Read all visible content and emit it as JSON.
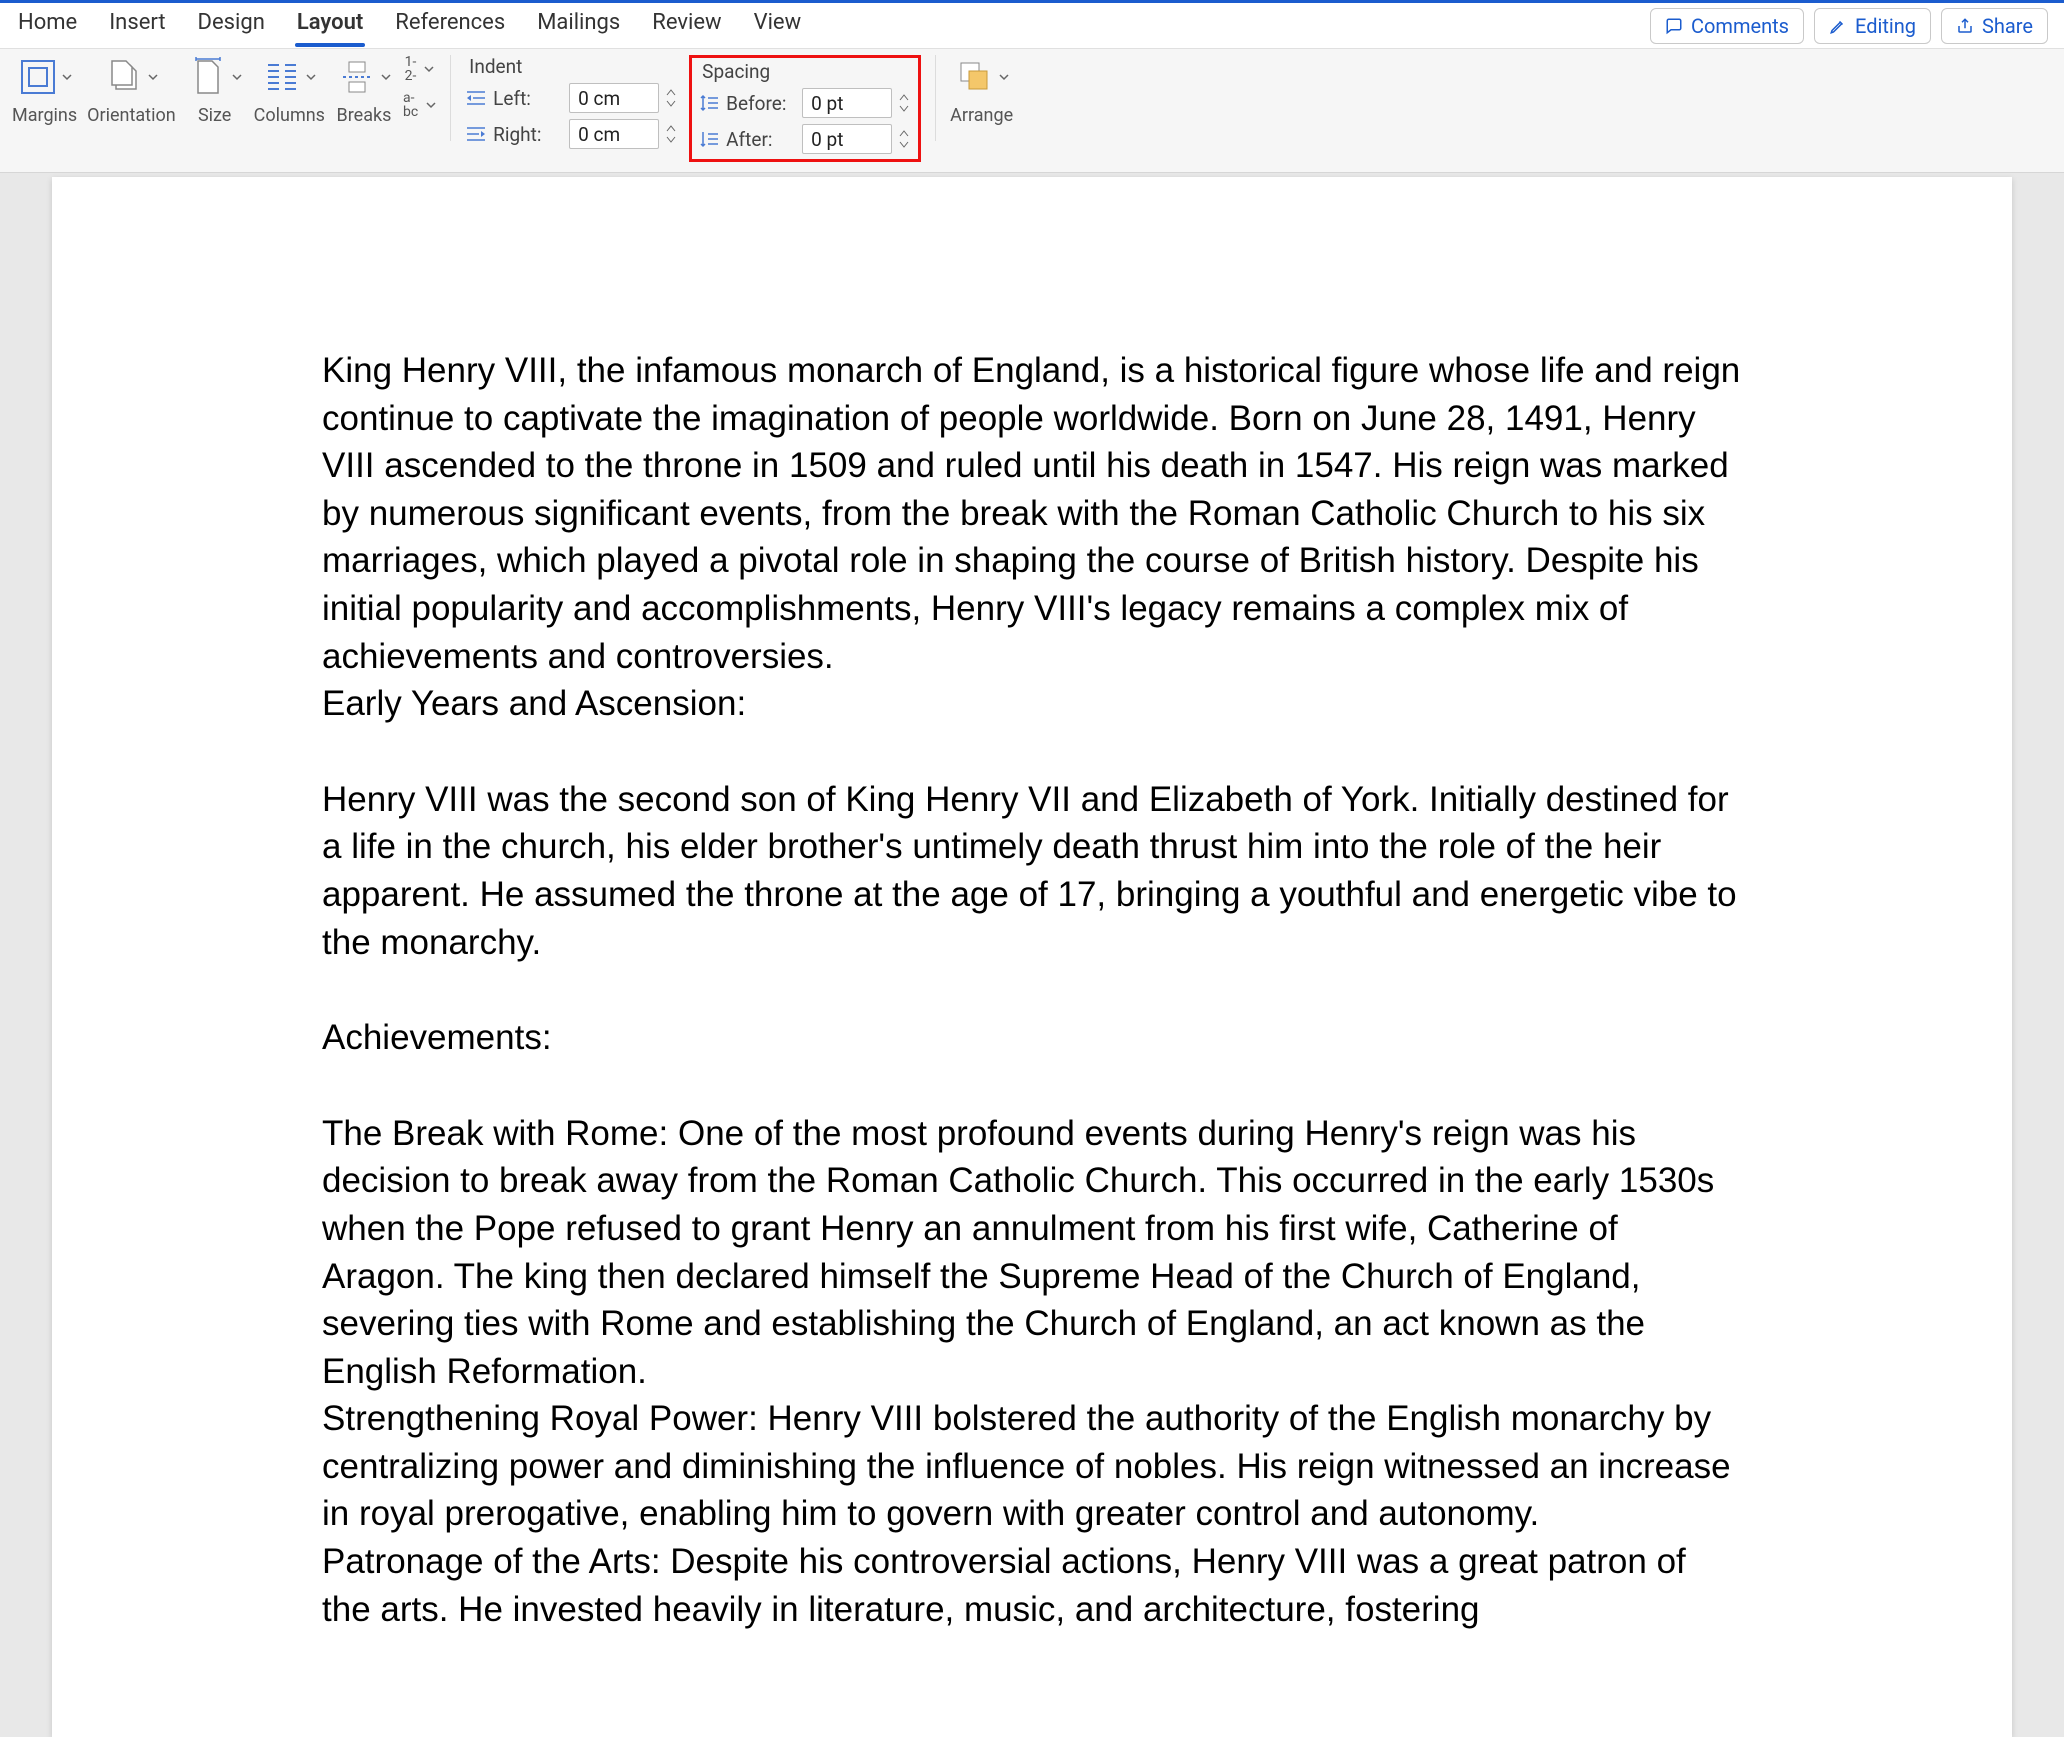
{
  "tabs": {
    "home": "Home",
    "insert": "Insert",
    "design": "Design",
    "layout": "Layout",
    "references": "References",
    "mailings": "Mailings",
    "review": "Review",
    "view": "View"
  },
  "actions": {
    "comments": "Comments",
    "editing": "Editing",
    "share": "Share"
  },
  "ribbon": {
    "margins": "Margins",
    "orientation": "Orientation",
    "size": "Size",
    "columns": "Columns",
    "breaks": "Breaks",
    "linenumbers": "1-\n2-",
    "hyphenation": "a-\nbc",
    "indent": {
      "title": "Indent",
      "left": "Left:",
      "right": "Right:",
      "left_val": "0 cm",
      "right_val": "0 cm"
    },
    "spacing": {
      "title": "Spacing",
      "before": "Before:",
      "after": "After:",
      "before_val": "0 pt",
      "after_val": "0 pt"
    },
    "arrange": "Arrange"
  },
  "doc": {
    "p1": "King Henry VIII, the infamous monarch of England, is a historical figure whose life and reign continue to captivate the imagination of people worldwide. Born on June 28, 1491, Henry VIII ascended to the throne in 1509 and ruled until his death in 1547. His reign was marked by numerous significant events, from the break with the Roman Catholic Church to his six marriages, which played a pivotal role in shaping the course of British history. Despite his initial popularity and accomplishments, Henry VIII's legacy remains a complex mix of achievements and controversies.",
    "p1b": "Early Years and Ascension:",
    "p2": "Henry VIII was the second son of King Henry VII and Elizabeth of York. Initially destined for a life in the church, his elder brother's untimely death thrust him into the role of the heir apparent. He assumed the throne at the age of 17, bringing a youthful and energetic vibe to the monarchy.",
    "p3": "Achievements:",
    "p4": "The Break with Rome: One of the most profound events during Henry's reign was his decision to break away from the Roman Catholic Church. This occurred in the early 1530s when the Pope refused to grant Henry an annulment from his first wife, Catherine of Aragon. The king then declared himself the Supreme Head of the Church of England, severing ties with Rome and establishing the Church of England, an act known as the English Reformation.",
    "p5": "Strengthening Royal Power: Henry VIII bolstered the authority of the English monarchy by centralizing power and diminishing the influence of nobles. His reign witnessed an increase in royal prerogative, enabling him to govern with greater control and autonomy.",
    "p6": "Patronage of the Arts: Despite his controversial actions, Henry VIII was a great patron of the arts. He invested heavily in literature, music, and architecture, fostering"
  }
}
